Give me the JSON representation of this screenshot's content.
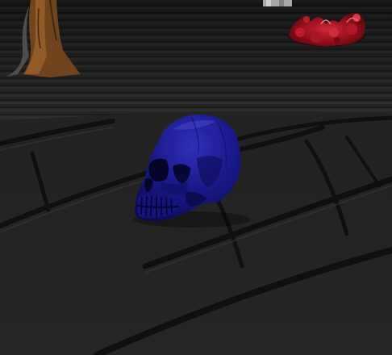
{
  "scene": {
    "objects": [
      {
        "name": "blue-skull",
        "color": "#1a1a8c"
      },
      {
        "name": "red-gore-pile",
        "color": "#b01020"
      },
      {
        "name": "dead-tree-trunk",
        "color": "#8a5a2a"
      }
    ],
    "colors": {
      "far_floor": "#2c2c2c",
      "near_floor": "#222222",
      "floor_seams": "#111111",
      "skull_highlight": "#3a3ad0"
    }
  }
}
